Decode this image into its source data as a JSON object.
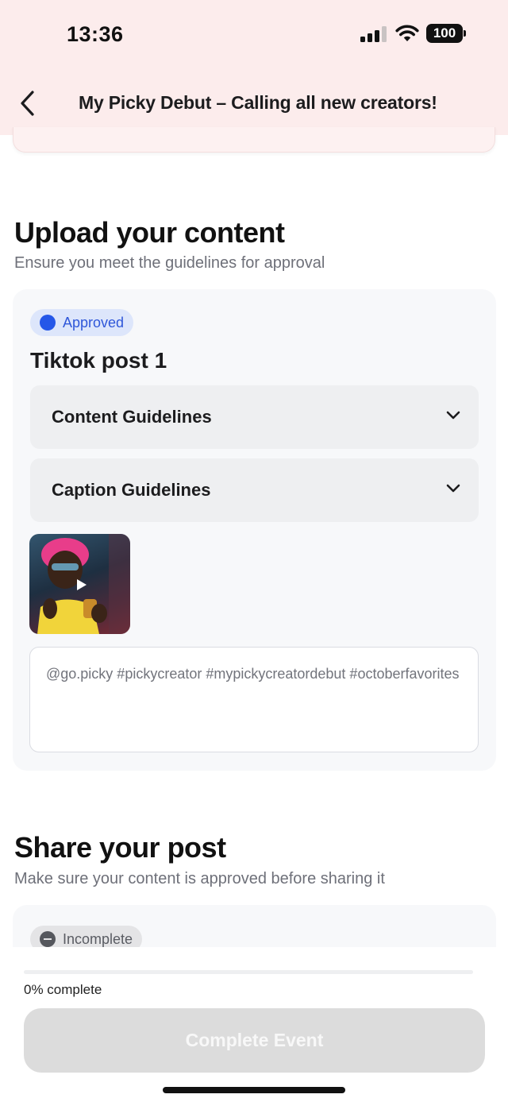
{
  "status_bar": {
    "time": "13:36",
    "battery": "100"
  },
  "header": {
    "title": "My Picky Debut – Calling all new creators!"
  },
  "upload_section": {
    "title": "Upload your content",
    "subtitle": "Ensure you meet the guidelines for approval",
    "card": {
      "status": "Approved",
      "post_title": "Tiktok post 1",
      "accordions": [
        {
          "label": "Content Guidelines"
        },
        {
          "label": "Caption Guidelines"
        }
      ],
      "caption": "@go.picky #pickycreator #mypickycreatordebut #octoberfavorites"
    }
  },
  "share_section": {
    "title": "Share your post",
    "subtitle": "Make sure your content is approved before sharing it",
    "card": {
      "status": "Incomplete"
    }
  },
  "footer": {
    "progress": 0,
    "progress_label": "0% complete",
    "button_label": "Complete Event"
  },
  "colors": {
    "header_bg": "#fcecec",
    "accent_blue": "#2557e8",
    "approved_badge_bg": "#dde6fb",
    "button_disabled_bg": "#dcdcdc"
  },
  "icons": {
    "back": "chevron-left-icon",
    "accordion": "chevron-down-icon",
    "approved": "blue-dot-icon",
    "incomplete": "minus-circle-icon",
    "video": "play-icon"
  }
}
